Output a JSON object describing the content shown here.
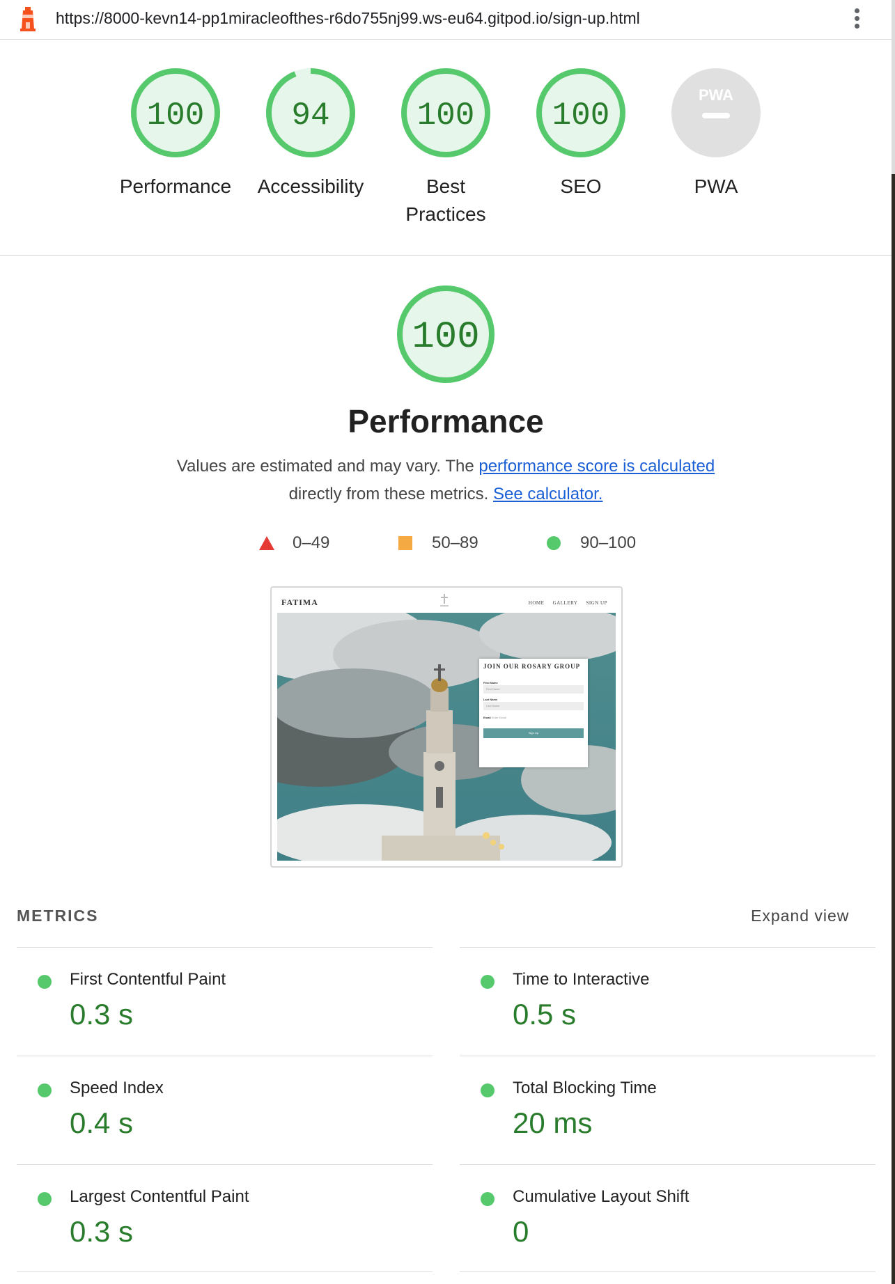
{
  "browser": {
    "url": "https://8000-kevn14-pp1miracleofthes-r6do755nj99.ws-eu64.gitpod.io/sign-up.html",
    "logo_icon": "lighthouse-icon",
    "menu_icon": "kebab-menu-icon"
  },
  "categories": [
    {
      "label": "Performance",
      "score": 100,
      "color": "#0cce6b"
    },
    {
      "label": "Accessibility",
      "score": 94,
      "color": "#0cce6b"
    },
    {
      "label": "Best Practices",
      "score": 100,
      "color": "#0cce6b"
    },
    {
      "label": "SEO",
      "score": 100,
      "color": "#0cce6b"
    },
    {
      "label": "PWA",
      "score": null,
      "badge_text": "PWA"
    }
  ],
  "performance": {
    "score": 100,
    "title": "Performance",
    "desc_prefix": "Values are estimated and may vary. The",
    "desc_link1": "performance score is calculated",
    "desc_mid": "directly from these metrics.",
    "desc_link2": "See calculator."
  },
  "legend": [
    {
      "range": "0–49",
      "shape": "triangle",
      "color": "#e53935"
    },
    {
      "range": "50–89",
      "shape": "square",
      "color": "#f4a942"
    },
    {
      "range": "90–100",
      "shape": "circle",
      "color": "#56c96d"
    }
  ],
  "preview": {
    "brand": "FATIMA",
    "nav": [
      "HOME",
      "GALLERY",
      "SIGN UP"
    ],
    "form_title": "JOIN OUR ROSARY GROUP",
    "first_name_label": "First Name",
    "first_name_placeholder": "First Name",
    "last_name_label": "Last Name",
    "last_name_placeholder": "Last Name",
    "email_label": "Email",
    "email_placeholder": "Enter Email",
    "button": "Sign Up"
  },
  "metrics": {
    "heading": "METRICS",
    "expand_label": "Expand view",
    "items": [
      {
        "title": "First Contentful Paint",
        "value": "0.3 s"
      },
      {
        "title": "Time to Interactive",
        "value": "0.5 s"
      },
      {
        "title": "Speed Index",
        "value": "0.4 s"
      },
      {
        "title": "Total Blocking Time",
        "value": "20 ms"
      },
      {
        "title": "Largest Contentful Paint",
        "value": "0.3 s"
      },
      {
        "title": "Cumulative Layout Shift",
        "value": "0"
      }
    ]
  }
}
